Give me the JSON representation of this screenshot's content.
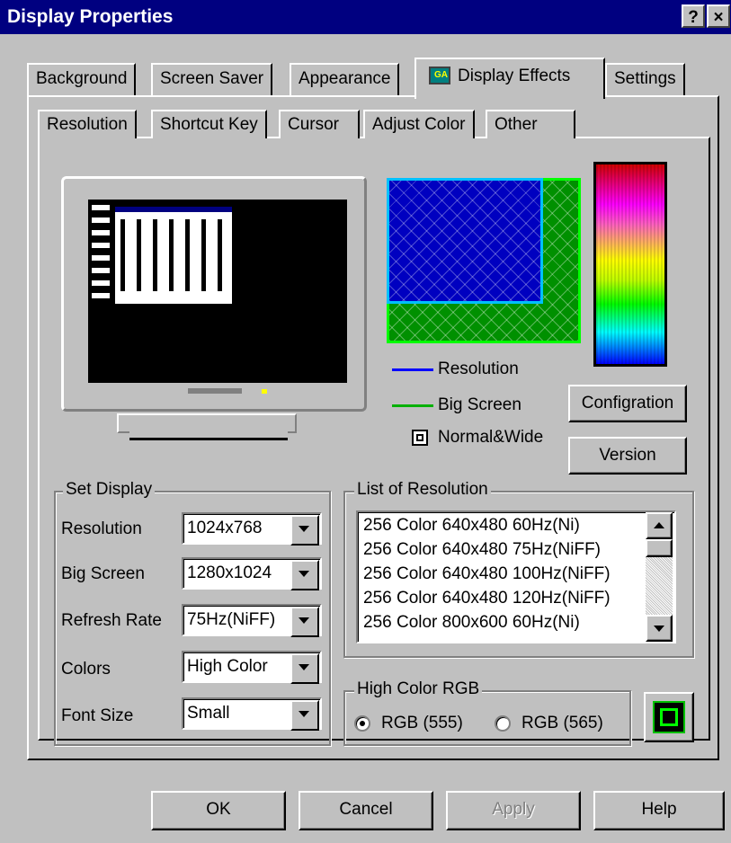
{
  "window": {
    "title": "Display Properties",
    "help_btn": "?",
    "close_btn": "×"
  },
  "tabs": [
    "Background",
    "Screen Saver",
    "Appearance",
    "Display Effects",
    "Settings"
  ],
  "subtabs": [
    "Resolution",
    "Shortcut Key",
    "Cursor",
    "Adjust Color",
    "Other"
  ],
  "legend": {
    "resolution": "Resolution",
    "big_screen": "Big Screen",
    "normal_wide": "Normal&Wide"
  },
  "buttons": {
    "configuration": "Configration",
    "version": "Version"
  },
  "set_display": {
    "title": "Set Display",
    "rows": [
      {
        "label": "Resolution",
        "value": "1024x768"
      },
      {
        "label": "Big Screen",
        "value": "1280x1024"
      },
      {
        "label": "Refresh Rate",
        "value": "75Hz(NiFF)"
      },
      {
        "label": "Colors",
        "value": "High Color"
      },
      {
        "label": "Font Size",
        "value": "Small"
      }
    ]
  },
  "resolution_list": {
    "title": "List of Resolution",
    "items": [
      "256 Color 640x480 60Hz(Ni)",
      "256 Color 640x480 75Hz(NiFF)",
      "256 Color 640x480 100Hz(NiFF)",
      "256 Color 640x480 120Hz(NiFF)",
      "256 Color 800x600 60Hz(Ni)"
    ]
  },
  "rgb": {
    "title": "High Color RGB",
    "option1": "RGB (555)",
    "option2": "RGB (565)",
    "selected": "RGB (555)"
  },
  "footer": {
    "ok": "OK",
    "cancel": "Cancel",
    "apply": "Apply",
    "help": "Help"
  },
  "colors": {
    "title_bg": "#000080",
    "face": "#c0c0c0",
    "resolution_line": "#0000ff",
    "big_screen_line": "#00b000"
  }
}
